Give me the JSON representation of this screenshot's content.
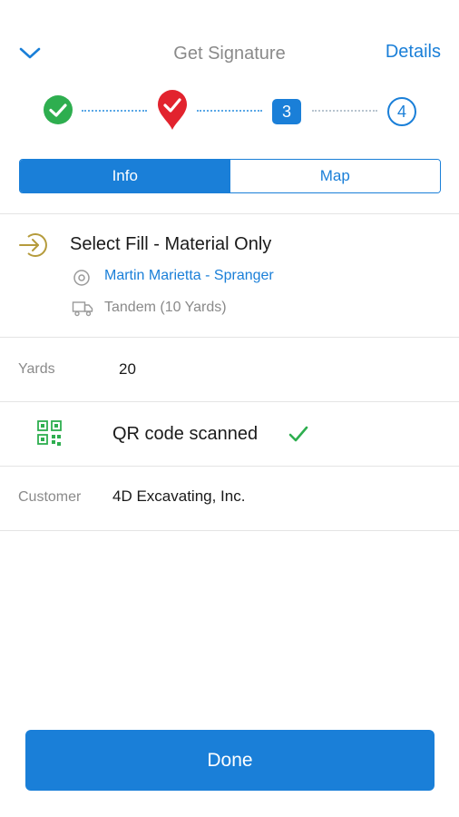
{
  "header": {
    "title": "Get Signature",
    "details_label": "Details"
  },
  "stepper": {
    "steps": [
      {
        "status": "complete",
        "icon": "check-circle-icon"
      },
      {
        "status": "current",
        "icon": "map-pin-check-icon"
      },
      {
        "label": "3"
      },
      {
        "label": "4"
      }
    ]
  },
  "tabs": [
    {
      "label": "Info",
      "active": true
    },
    {
      "label": "Map",
      "active": false
    }
  ],
  "job": {
    "title": "Select Fill - Material Only",
    "site": "Martin Marietta - Spranger",
    "truck": "Tandem (10 Yards)"
  },
  "yards": {
    "label": "Yards",
    "value": "20"
  },
  "qr": {
    "label": "QR code scanned"
  },
  "customer": {
    "label": "Customer",
    "value": "4D Excavating, Inc."
  },
  "actions": {
    "done_label": "Done"
  },
  "colors": {
    "accent": "#1a7fd8",
    "success": "#2eae4f",
    "marker_red": "#e2232e",
    "signin_gold": "#b59b3c"
  }
}
